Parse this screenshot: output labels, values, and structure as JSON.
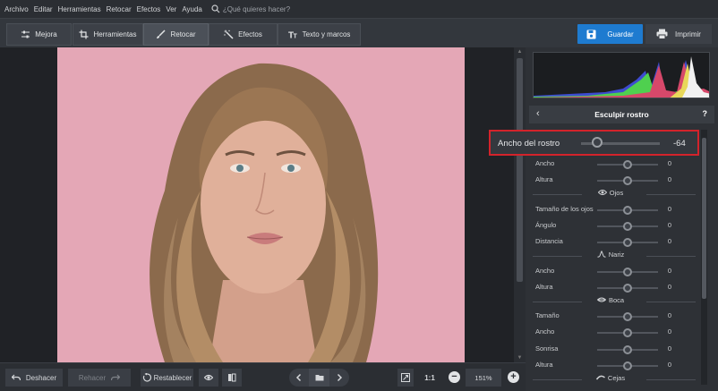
{
  "menu": {
    "items": [
      "Archivo",
      "Editar",
      "Herramientas",
      "Retocar",
      "Efectos",
      "Ver",
      "Ayuda"
    ],
    "search_placeholder": "¿Qué quieres hacer?"
  },
  "toolbar": {
    "tabs": [
      {
        "label": "Mejora",
        "icon": "sliders-icon",
        "active": false
      },
      {
        "label": "Herramientas",
        "icon": "crop-icon",
        "active": false
      },
      {
        "label": "Retocar",
        "icon": "brush-icon",
        "active": true
      },
      {
        "label": "Efectos",
        "icon": "magic-wand-icon",
        "active": false
      },
      {
        "label": "Texto y marcos",
        "icon": "text-icon",
        "active": false
      }
    ],
    "save_label": "Guardar",
    "print_label": "Imprimir",
    "accent_color": "#1e7bd0"
  },
  "panel": {
    "title": "Esculpir rostro",
    "help": "?",
    "face_width": {
      "label": "Ancho del rostro",
      "value": "-64",
      "level": -64
    },
    "rows": [
      {
        "label": "Ancho",
        "value": "0"
      },
      {
        "label": "Altura",
        "value": "0"
      }
    ],
    "sections": {
      "eyes": "Ojos",
      "nose": "Nariz",
      "mouth": "Boca",
      "brows": "Cejas"
    },
    "eye_rows": [
      {
        "label": "Tamaño de los ojos",
        "value": "0"
      },
      {
        "label": "Ángulo",
        "value": "0"
      },
      {
        "label": "Distancia",
        "value": "0"
      }
    ],
    "nose_rows": [
      {
        "label": "Ancho",
        "value": "0"
      },
      {
        "label": "Altura",
        "value": "0"
      }
    ],
    "mouth_rows": [
      {
        "label": "Tamaño",
        "value": "0"
      },
      {
        "label": "Ancho",
        "value": "0"
      },
      {
        "label": "Sonrisa",
        "value": "0"
      },
      {
        "label": "Altura",
        "value": "0"
      }
    ]
  },
  "bottombar": {
    "undo_label": "Deshacer",
    "redo_label": "Rehacer",
    "reset_label": "Restablecer",
    "one_to_one": "1:1",
    "zoom": "151%",
    "minus": "−",
    "plus": "+"
  },
  "photo": {
    "background": "#e4a7b6"
  }
}
